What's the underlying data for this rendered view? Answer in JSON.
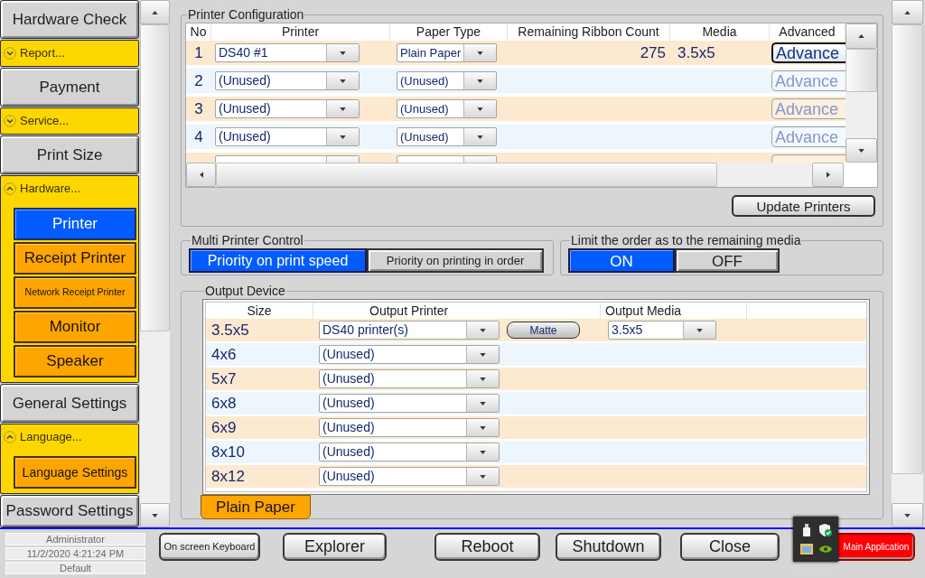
{
  "sidebar": {
    "items": [
      {
        "kind": "button",
        "label": "Hardware Check"
      },
      {
        "kind": "group",
        "label": "Report...",
        "expanded": false
      },
      {
        "kind": "button",
        "label": "Payment"
      },
      {
        "kind": "group",
        "label": "Service...",
        "expanded": false
      },
      {
        "kind": "button",
        "label": "Print Size"
      },
      {
        "kind": "group",
        "label": "Hardware...",
        "expanded": true,
        "children": [
          {
            "label": "Printer",
            "selected": true
          },
          {
            "label": "Receipt Printer",
            "selected": false
          },
          {
            "label": "Network Receipt Printer",
            "selected": false
          },
          {
            "label": "Monitor",
            "selected": false
          },
          {
            "label": "Speaker",
            "selected": false
          }
        ]
      },
      {
        "kind": "button",
        "label": "General Settings"
      },
      {
        "kind": "group",
        "label": "Language...",
        "expanded": true,
        "children": [
          {
            "label": "Language Settings",
            "selected": false
          }
        ]
      },
      {
        "kind": "button",
        "label": "Password Settings"
      }
    ]
  },
  "printer_configuration": {
    "title": "Printer Configuration",
    "columns": [
      "No",
      "Printer",
      "Paper Type",
      "Remaining Ribbon Count",
      "Media",
      "Advanced"
    ],
    "rows": [
      {
        "no": "1",
        "printer": "DS40 #1",
        "paper_type": "Plain Paper",
        "remaining_ribbon_count": "275",
        "media": "3.5x5",
        "advanced": "Advance",
        "disabled": false
      },
      {
        "no": "2",
        "printer": "(Unused)",
        "paper_type": "(Unused)",
        "advanced": "Advance",
        "disabled": true
      },
      {
        "no": "3",
        "printer": "(Unused)",
        "paper_type": "(Unused)",
        "advanced": "Advance",
        "disabled": true
      },
      {
        "no": "4",
        "printer": "(Unused)",
        "paper_type": "(Unused)",
        "advanced": "Advance",
        "disabled": true
      },
      {
        "disabled": true
      }
    ],
    "update_button": "Update Printers"
  },
  "multi_printer_control": {
    "title": "Multi Printer Control",
    "options": [
      {
        "label": "Priority on print speed",
        "selected": true
      },
      {
        "label": "Priority on printing in order",
        "selected": false
      }
    ]
  },
  "limit_order": {
    "title": "Limit the order as to the remaining media",
    "options": [
      {
        "label": "ON",
        "selected": true
      },
      {
        "label": "OFF",
        "selected": false
      }
    ]
  },
  "output_device": {
    "title": "Output Device",
    "columns": [
      "Size",
      "Output Printer",
      "Output Media"
    ],
    "rows": [
      {
        "size": "3.5x5",
        "output_printer": "DS40 printer(s)",
        "paper": "Matte",
        "output_media": "3.5x5"
      },
      {
        "size": "4x6",
        "output_printer": "(Unused)"
      },
      {
        "size": "5x7",
        "output_printer": "(Unused)"
      },
      {
        "size": "6x8",
        "output_printer": "(Unused)"
      },
      {
        "size": "6x9",
        "output_printer": "(Unused)"
      },
      {
        "size": "8x10",
        "output_printer": "(Unused)"
      },
      {
        "size": "8x12",
        "output_printer": "(Unused)"
      }
    ],
    "tabs": [
      {
        "label": "Plain Paper",
        "selected": true
      }
    ]
  },
  "status": [
    "Administrator",
    "11/2/2020 4:21:24 PM",
    "Default"
  ],
  "buttons": [
    {
      "label": "On screen Keyboard",
      "kind": "small"
    },
    {
      "label": "Explorer",
      "kind": "normal"
    },
    {
      "label": "Reboot",
      "kind": "normal"
    },
    {
      "label": "Shutdown",
      "kind": "normal"
    },
    {
      "label": "Close",
      "kind": "normal"
    },
    {
      "label": "Main Application",
      "kind": "alert"
    }
  ]
}
